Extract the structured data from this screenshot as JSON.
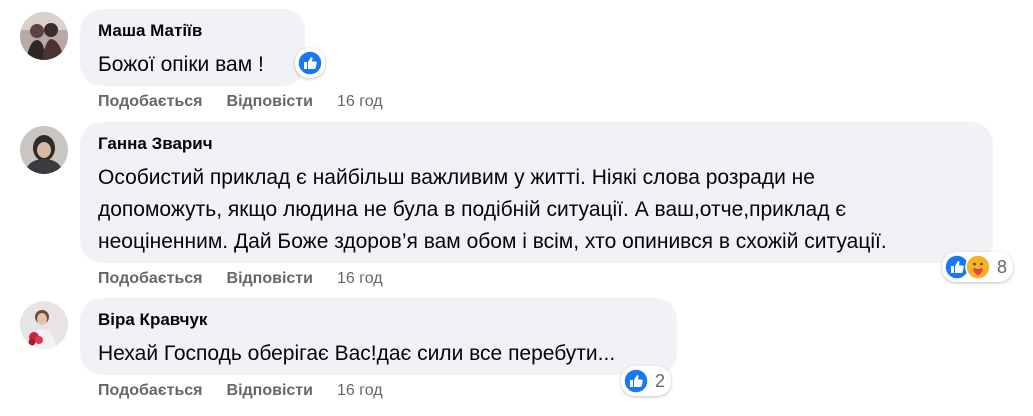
{
  "colors": {
    "bubble_bg": "#f0f2f5",
    "meta_text": "#65676b",
    "like_blue": "#1877f2",
    "care_yellow": "#f7b125"
  },
  "comments": [
    {
      "author": "Маша Матіїв",
      "text": "Божої опіки вам !",
      "actions": {
        "like": "Подобається",
        "reply": "Відповісти"
      },
      "time": "16 год",
      "reactions": {
        "icons": [
          "like-icon"
        ],
        "count": ""
      }
    },
    {
      "author": "Ганна Зварич",
      "text": "Особистий приклад є найбільш важливим у житті. Ніякі слова розради не\nдопоможуть, якщо людина не була в подібній ситуації. А ваш,отче,приклад є\nнеоціненним. Дай Боже здоров’я вам обом і всім, хто опинився в схожій ситуації.",
      "actions": {
        "like": "Подобається",
        "reply": "Відповісти"
      },
      "time": "16 год",
      "reactions": {
        "icons": [
          "like-icon",
          "care-icon"
        ],
        "count": "8"
      }
    },
    {
      "author": "Віра Кравчук",
      "text": "Нехай Господь оберігає Вас!дає сили все перебути...",
      "actions": {
        "like": "Подобається",
        "reply": "Відповісти"
      },
      "time": "16 год",
      "reactions": {
        "icons": [
          "like-icon"
        ],
        "count": "2"
      }
    }
  ]
}
